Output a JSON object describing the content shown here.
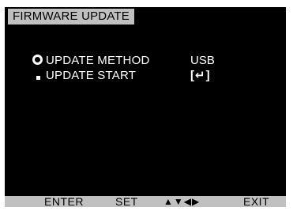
{
  "header": {
    "title": "FIRMWARE UPDATE"
  },
  "menu": {
    "items": [
      {
        "label": "UPDATE METHOD",
        "value": "USB",
        "bullet_icon": "ring-bullet-icon",
        "selected": true
      },
      {
        "label": "UPDATE START",
        "value": "[↵]",
        "bullet_icon": "square-bullet-icon",
        "selected": false
      }
    ]
  },
  "footer": {
    "enter_label": "ENTER",
    "set_label": "SET",
    "arrows_label": "▲▼◀▶",
    "exit_label": "EXIT"
  },
  "colors": {
    "background": "#000000",
    "text": "#ffffff",
    "bar": "#c0c0c0",
    "bar_text": "#000000"
  }
}
